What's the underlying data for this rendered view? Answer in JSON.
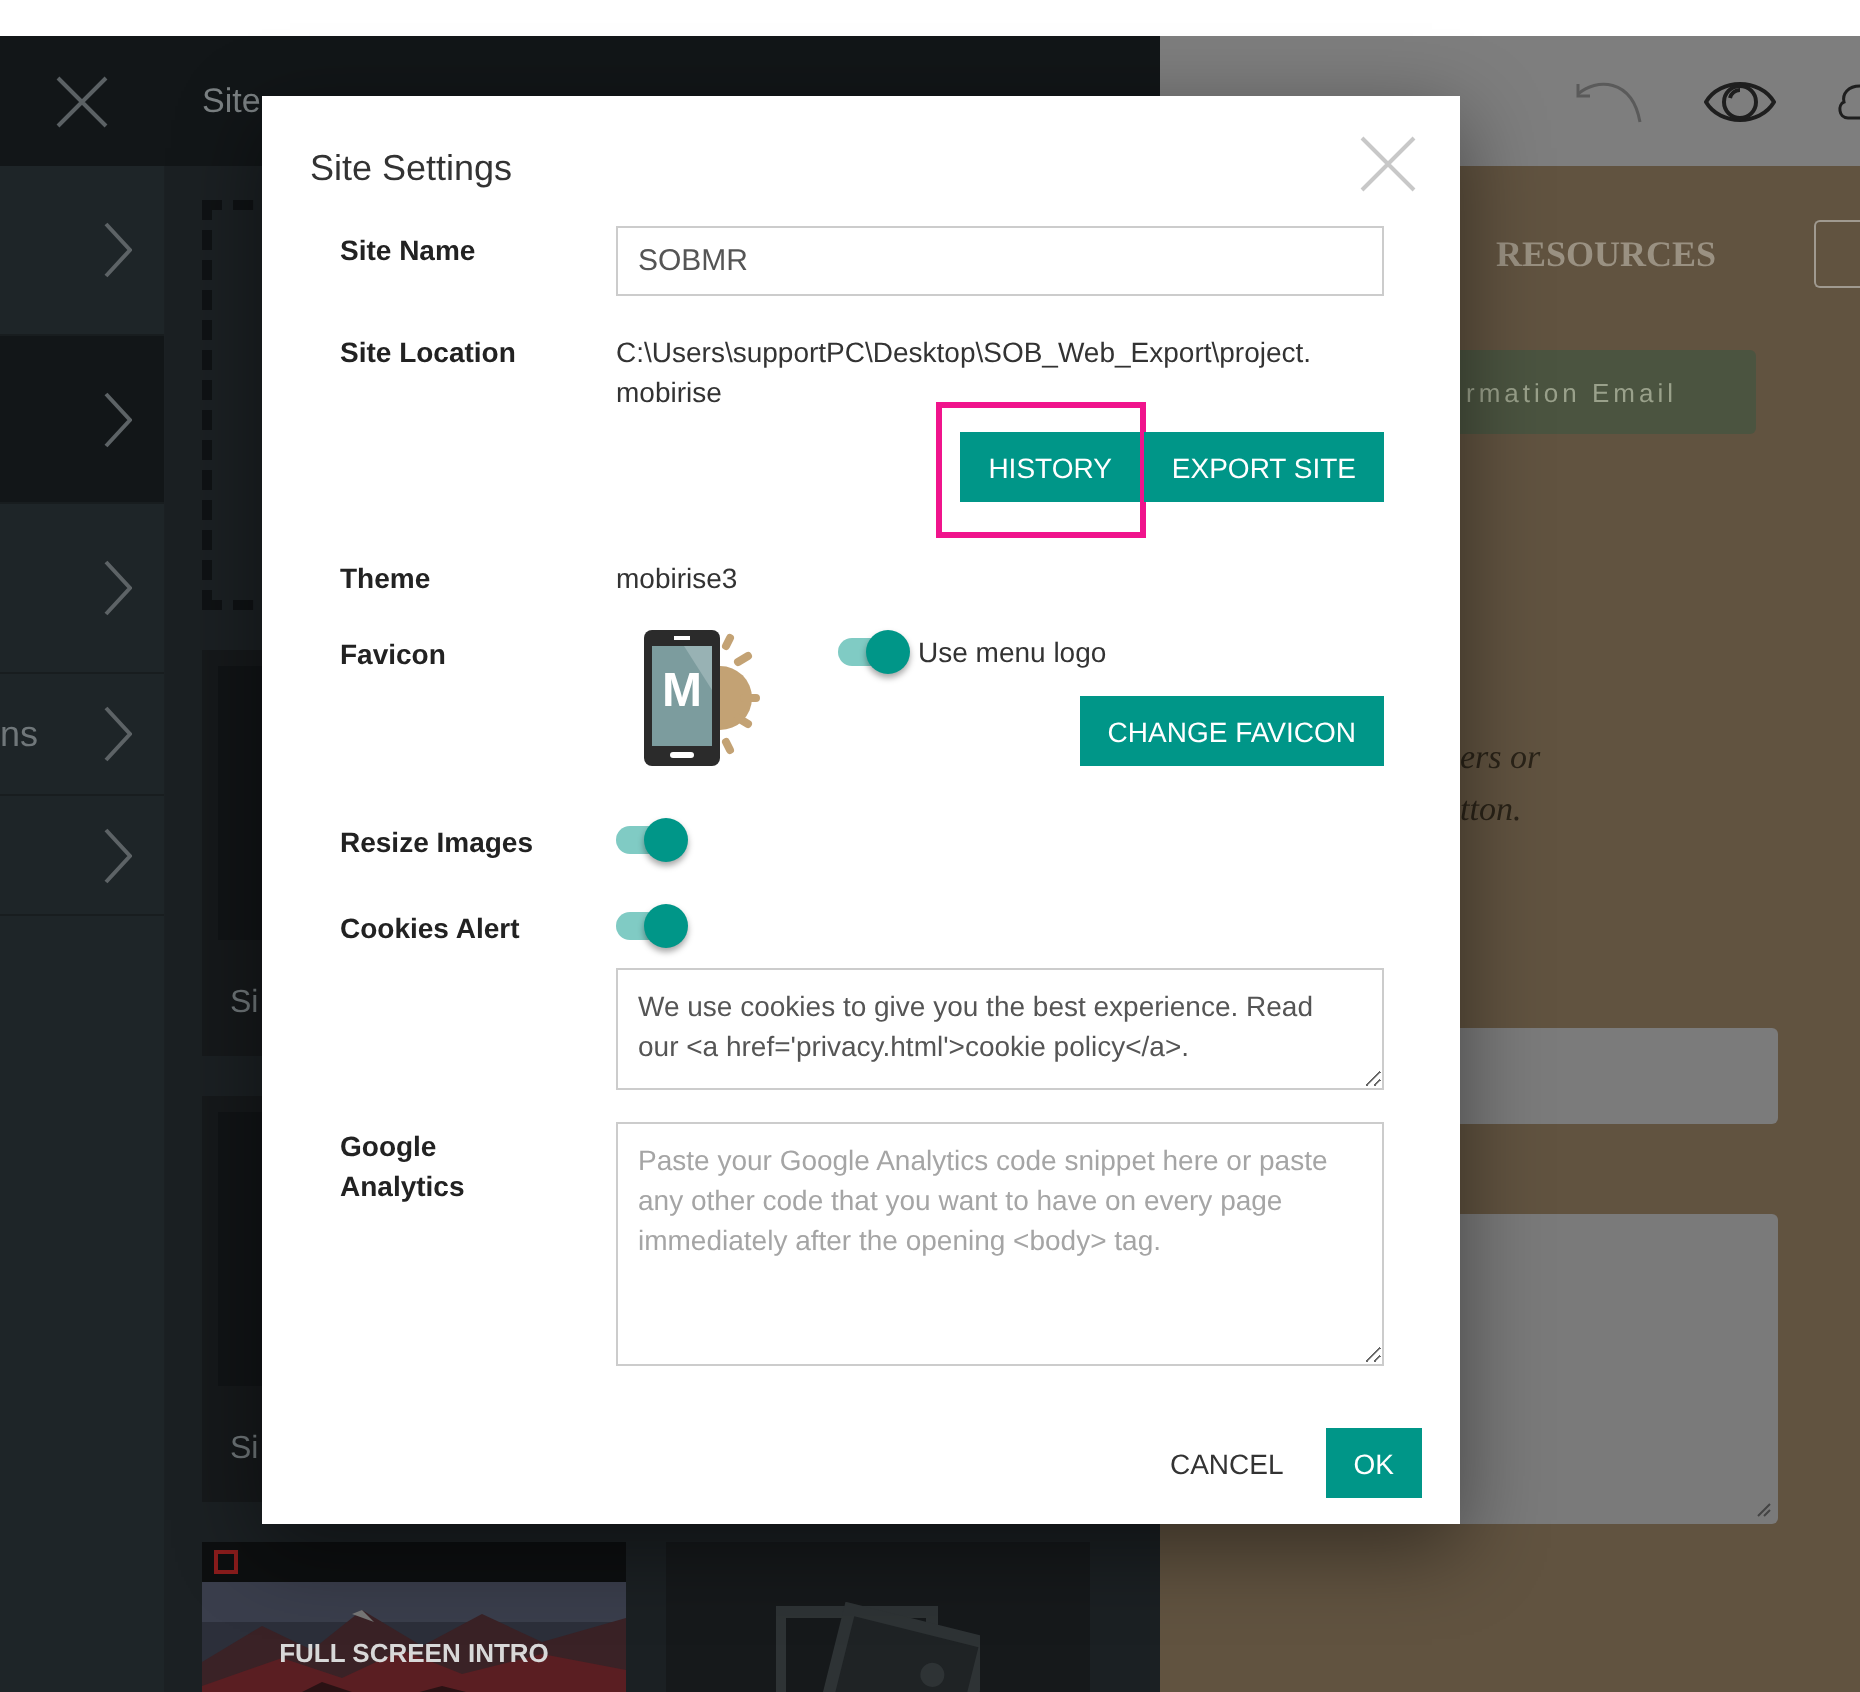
{
  "app_sidebar": {
    "items": [
      {
        "selected": false
      },
      {
        "selected": true
      },
      {
        "selected": false
      },
      {
        "label": "ns",
        "selected": false
      },
      {
        "selected": false
      }
    ]
  },
  "sites_panel": {
    "title": "Site",
    "cards": [
      {
        "label": "Si"
      },
      {
        "label": "Si"
      }
    ],
    "thumbnails": [
      {
        "kind": "template",
        "title": "FULL SCREEN INTRO"
      },
      {
        "kind": "empty"
      }
    ]
  },
  "preview": {
    "nav_link": "RESOURCES",
    "button": "rmation Email",
    "text_lines": [
      "ers or",
      "tton."
    ]
  },
  "dialog": {
    "title": "Site Settings",
    "fields": [
      {
        "kind": "input",
        "label": "Site Name",
        "value": "SOBMR"
      },
      {
        "kind": "location",
        "label": "Site Location",
        "value": "C:\\Users\\supportPC\\Desktop\\SOB_Web_Export\\project.mobirise",
        "buttons": [
          {
            "label": "HISTORY",
            "highlighted": true
          },
          {
            "label": "EXPORT SITE",
            "highlighted": false
          }
        ]
      },
      {
        "kind": "text",
        "label": "Theme",
        "value": "mobirise3"
      },
      {
        "kind": "favicon",
        "label": "Favicon",
        "logo_letter": "M",
        "toggle": {
          "label": "Use menu logo",
          "on": true
        },
        "button": "CHANGE FAVICON"
      },
      {
        "kind": "toggle",
        "label": "Resize Images",
        "on": true
      },
      {
        "kind": "toggle_text",
        "label": "Cookies Alert",
        "on": true,
        "value": "We use cookies to give you the best experience. Read our <a href='privacy.html'>cookie policy</a>."
      },
      {
        "kind": "textarea",
        "label": "Google Analytics",
        "placeholder": "Paste your Google Analytics code snippet here or paste any other code that you want to have on every page immediately after the opening <body> tag."
      }
    ],
    "buttons": [
      {
        "kind": "flat",
        "label": "CANCEL"
      },
      {
        "kind": "primary",
        "label": "OK"
      }
    ]
  }
}
